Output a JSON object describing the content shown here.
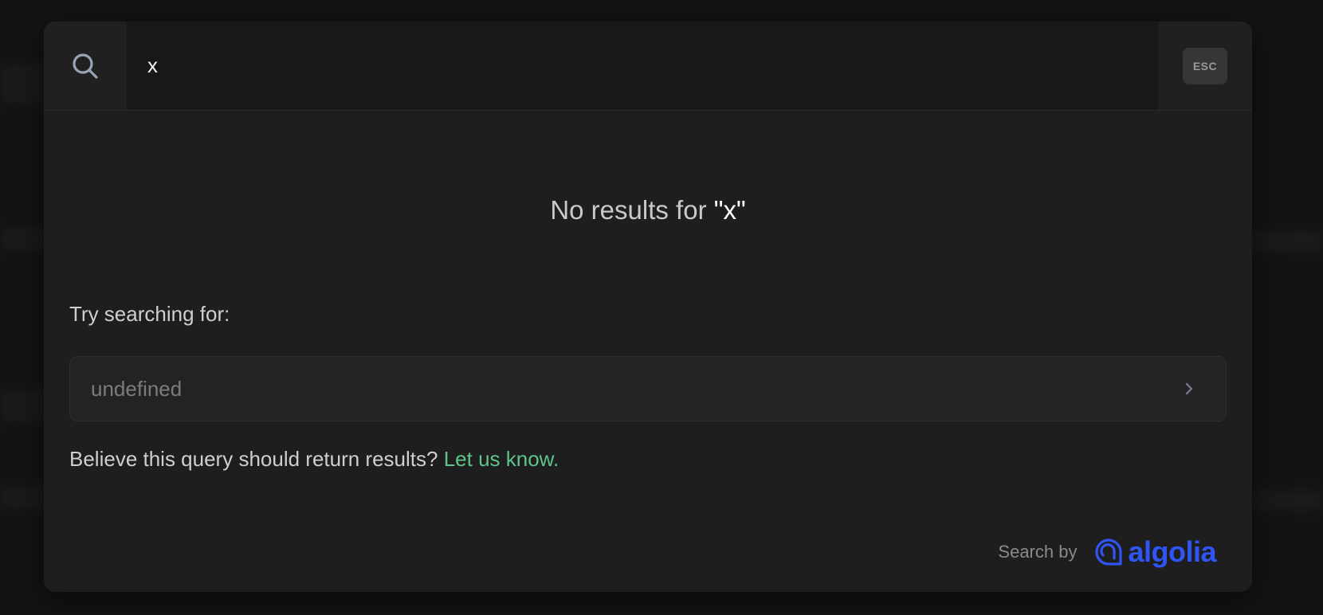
{
  "search": {
    "value": "x",
    "placeholder": ""
  },
  "esc_label": "ESC",
  "no_results": {
    "prefix": "No results for ",
    "query": "\"x\""
  },
  "try_label": "Try searching for:",
  "suggestions": [
    {
      "label": "undefined"
    }
  ],
  "feedback": {
    "text": "Believe this query should return results? ",
    "link": "Let us know."
  },
  "footer": {
    "search_by": "Search by",
    "brand": "algolia"
  },
  "colors": {
    "accent_link": "#5ec48b",
    "brand": "#2f55f5",
    "modal_bg": "#1e1e1e"
  },
  "icons": {
    "search": "search-icon",
    "chevron": "chevron-right-icon",
    "brand_logo": "algolia-logo-icon"
  }
}
